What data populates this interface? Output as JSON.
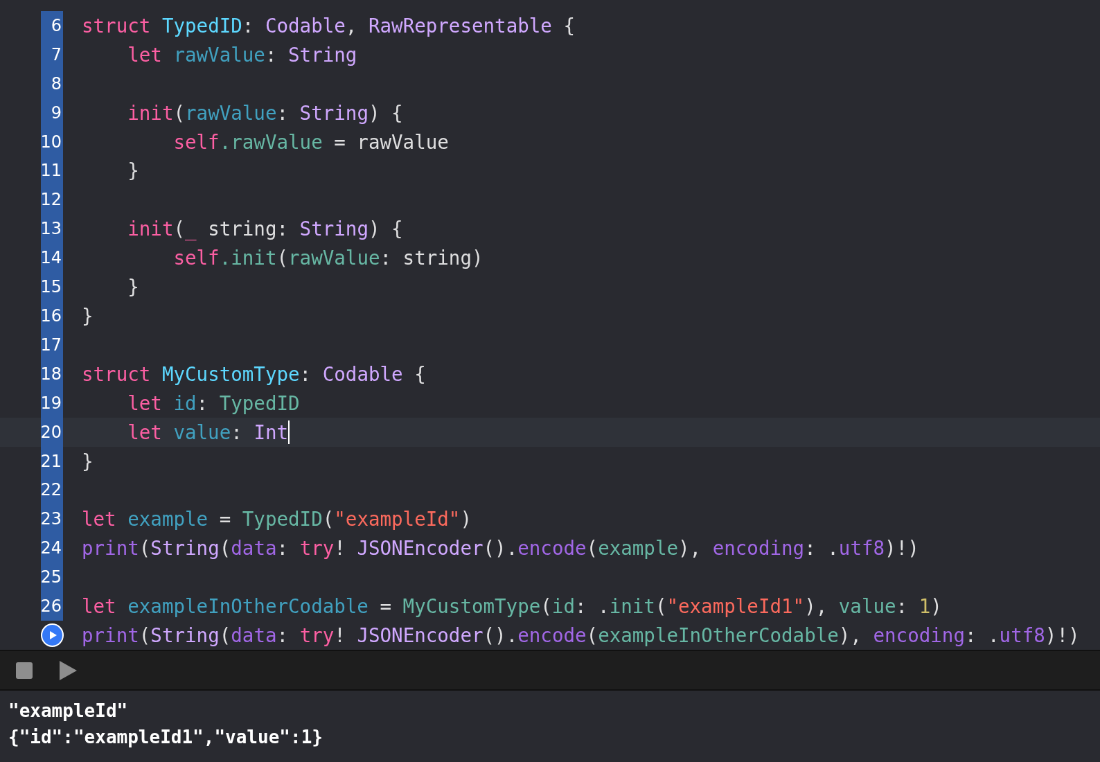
{
  "editor": {
    "lines": [
      {
        "number": "6",
        "current": false,
        "tokens": [
          {
            "kind": "keyword",
            "text": "struct "
          },
          {
            "kind": "typedecl",
            "text": "TypedID"
          },
          {
            "kind": "plain",
            "text": ": "
          },
          {
            "kind": "libtype",
            "text": "Codable"
          },
          {
            "kind": "plain",
            "text": ", "
          },
          {
            "kind": "libtype",
            "text": "RawRepresentable"
          },
          {
            "kind": "plain",
            "text": " {"
          }
        ]
      },
      {
        "number": "7",
        "current": false,
        "tokens": [
          {
            "kind": "keyword",
            "text": "    let "
          },
          {
            "kind": "decl",
            "text": "rawValue"
          },
          {
            "kind": "plain",
            "text": ": "
          },
          {
            "kind": "libtype",
            "text": "String"
          }
        ]
      },
      {
        "number": "8",
        "current": false
      },
      {
        "number": "9",
        "current": false,
        "tokens": [
          {
            "kind": "keyword",
            "text": "    init"
          },
          {
            "kind": "plain",
            "text": "("
          },
          {
            "kind": "decl",
            "text": "rawValue"
          },
          {
            "kind": "plain",
            "text": ": "
          },
          {
            "kind": "libtype",
            "text": "String"
          },
          {
            "kind": "plain",
            "text": ") {"
          }
        ]
      },
      {
        "number": "10",
        "current": false,
        "tokens": [
          {
            "kind": "keyword",
            "text": "        self"
          },
          {
            "kind": "member",
            "text": ".rawValue"
          },
          {
            "kind": "plain",
            "text": " = rawValue"
          }
        ]
      },
      {
        "number": "11",
        "current": false,
        "tokens": [
          {
            "kind": "plain",
            "text": "    }"
          }
        ]
      },
      {
        "number": "12",
        "current": false
      },
      {
        "number": "13",
        "current": false,
        "tokens": [
          {
            "kind": "keyword",
            "text": "    init"
          },
          {
            "kind": "plain",
            "text": "("
          },
          {
            "kind": "keyword",
            "text": "_"
          },
          {
            "kind": "plain",
            "text": " string: "
          },
          {
            "kind": "libtype",
            "text": "String"
          },
          {
            "kind": "plain",
            "text": ") {"
          }
        ]
      },
      {
        "number": "14",
        "current": false,
        "tokens": [
          {
            "kind": "keyword",
            "text": "        self"
          },
          {
            "kind": "member",
            "text": ".init"
          },
          {
            "kind": "plain",
            "text": "("
          },
          {
            "kind": "member",
            "text": "rawValue"
          },
          {
            "kind": "plain",
            "text": ": string)"
          }
        ]
      },
      {
        "number": "15",
        "current": false,
        "tokens": [
          {
            "kind": "plain",
            "text": "    }"
          }
        ]
      },
      {
        "number": "16",
        "current": false,
        "tokens": [
          {
            "kind": "plain",
            "text": "}"
          }
        ]
      },
      {
        "number": "17",
        "current": false
      },
      {
        "number": "18",
        "current": false,
        "tokens": [
          {
            "kind": "keyword",
            "text": "struct "
          },
          {
            "kind": "typedecl",
            "text": "MyCustomType"
          },
          {
            "kind": "plain",
            "text": ": "
          },
          {
            "kind": "libtype",
            "text": "Codable"
          },
          {
            "kind": "plain",
            "text": " {"
          }
        ]
      },
      {
        "number": "19",
        "current": false,
        "tokens": [
          {
            "kind": "keyword",
            "text": "    let "
          },
          {
            "kind": "decl",
            "text": "id"
          },
          {
            "kind": "plain",
            "text": ": "
          },
          {
            "kind": "member",
            "text": "TypedID"
          }
        ]
      },
      {
        "number": "20",
        "current": true,
        "tokens": [
          {
            "kind": "keyword",
            "text": "    let "
          },
          {
            "kind": "decl",
            "text": "value"
          },
          {
            "kind": "plain",
            "text": ": "
          },
          {
            "kind": "libtype",
            "text": "Int"
          }
        ]
      },
      {
        "number": "21",
        "current": false,
        "tokens": [
          {
            "kind": "plain",
            "text": "}"
          }
        ]
      },
      {
        "number": "22",
        "current": false
      },
      {
        "number": "23",
        "current": false,
        "tokens": [
          {
            "kind": "keyword",
            "text": "let "
          },
          {
            "kind": "decl",
            "text": "example"
          },
          {
            "kind": "plain",
            "text": " = "
          },
          {
            "kind": "member",
            "text": "TypedID"
          },
          {
            "kind": "plain",
            "text": "("
          },
          {
            "kind": "string",
            "text": "\"exampleId\""
          },
          {
            "kind": "plain",
            "text": ")"
          }
        ]
      },
      {
        "number": "24",
        "current": false,
        "tokens": [
          {
            "kind": "lib",
            "text": "print"
          },
          {
            "kind": "plain",
            "text": "("
          },
          {
            "kind": "libtype",
            "text": "String"
          },
          {
            "kind": "plain",
            "text": "("
          },
          {
            "kind": "lib",
            "text": "data"
          },
          {
            "kind": "plain",
            "text": ": "
          },
          {
            "kind": "keyword",
            "text": "try"
          },
          {
            "kind": "plain",
            "text": "! "
          },
          {
            "kind": "libtype",
            "text": "JSONEncoder"
          },
          {
            "kind": "plain",
            "text": "()."
          },
          {
            "kind": "lib",
            "text": "encode"
          },
          {
            "kind": "plain",
            "text": "("
          },
          {
            "kind": "member",
            "text": "example"
          },
          {
            "kind": "plain",
            "text": "), "
          },
          {
            "kind": "lib",
            "text": "encoding"
          },
          {
            "kind": "plain",
            "text": ": ."
          },
          {
            "kind": "lib",
            "text": "utf8"
          },
          {
            "kind": "plain",
            "text": ")!)"
          }
        ]
      },
      {
        "number": "25",
        "current": false
      },
      {
        "number": "26",
        "current": false,
        "tokens": [
          {
            "kind": "keyword",
            "text": "let "
          },
          {
            "kind": "decl",
            "text": "exampleInOtherCodable"
          },
          {
            "kind": "plain",
            "text": " = "
          },
          {
            "kind": "member",
            "text": "MyCustomType"
          },
          {
            "kind": "plain",
            "text": "("
          },
          {
            "kind": "member",
            "text": "id"
          },
          {
            "kind": "plain",
            "text": ": ."
          },
          {
            "kind": "member",
            "text": "init"
          },
          {
            "kind": "plain",
            "text": "("
          },
          {
            "kind": "string",
            "text": "\"exampleId1\""
          },
          {
            "kind": "plain",
            "text": "), "
          },
          {
            "kind": "member",
            "text": "value"
          },
          {
            "kind": "plain",
            "text": ": "
          },
          {
            "kind": "number",
            "text": "1"
          },
          {
            "kind": "plain",
            "text": ")"
          }
        ]
      },
      {
        "current": false,
        "tokens": [
          {
            "kind": "lib",
            "text": "print"
          },
          {
            "kind": "plain",
            "text": "("
          },
          {
            "kind": "libtype",
            "text": "String"
          },
          {
            "kind": "plain",
            "text": "("
          },
          {
            "kind": "lib",
            "text": "data"
          },
          {
            "kind": "plain",
            "text": ": "
          },
          {
            "kind": "keyword",
            "text": "try"
          },
          {
            "kind": "plain",
            "text": "! "
          },
          {
            "kind": "libtype",
            "text": "JSONEncoder"
          },
          {
            "kind": "plain",
            "text": "()."
          },
          {
            "kind": "lib",
            "text": "encode"
          },
          {
            "kind": "plain",
            "text": "("
          },
          {
            "kind": "member",
            "text": "exampleInOtherCodable"
          },
          {
            "kind": "plain",
            "text": "), "
          },
          {
            "kind": "lib",
            "text": "encoding"
          },
          {
            "kind": "plain",
            "text": ": ."
          },
          {
            "kind": "lib",
            "text": "utf8"
          },
          {
            "kind": "plain",
            "text": ")!)"
          }
        ]
      }
    ]
  },
  "console": {
    "output": [
      "\"exampleId\"",
      "{\"id\":\"exampleId1\",\"value\":1}"
    ]
  }
}
